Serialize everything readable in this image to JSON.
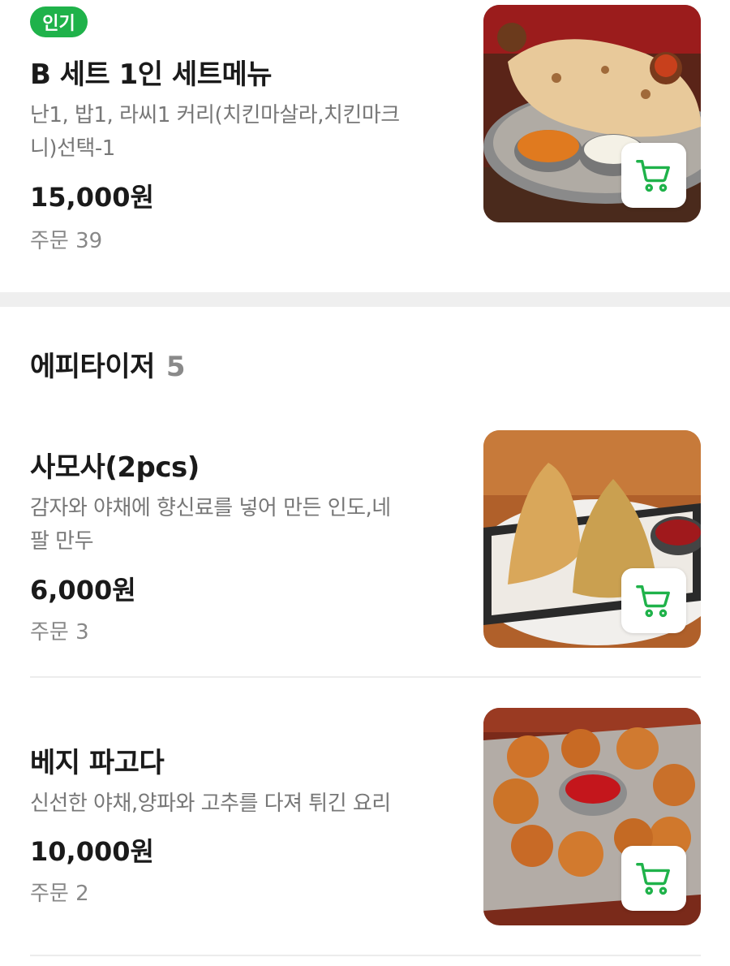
{
  "colors": {
    "accent": "#1fb24a",
    "text": "#1a1a1a",
    "muted": "#777777",
    "gap": "#efefef"
  },
  "items": [
    {
      "badge": "인기",
      "title": "B 세트 1인 세트메뉴",
      "desc_lines": [
        "난1, 밥1, 라씨1 커리(치킨마살라,치킨마크",
        "니)선택-1"
      ],
      "price": "15,000원",
      "orders": "주문 39",
      "icon": "cart-icon"
    },
    {
      "title": "사모사(2pcs)",
      "desc_lines": [
        "감자와 야채에 향신료를 넣어 만든 인도,네",
        "팔 만두"
      ],
      "price": "6,000원",
      "orders": "주문 3",
      "icon": "cart-icon"
    },
    {
      "title": "베지 파고다",
      "desc_lines": [
        "신선한 야채,양파와 고추를 다져 튀긴 요리"
      ],
      "price": "10,000원",
      "orders": "주문 2",
      "icon": "cart-icon"
    }
  ],
  "section": {
    "title": "에피타이저",
    "count": "5"
  }
}
